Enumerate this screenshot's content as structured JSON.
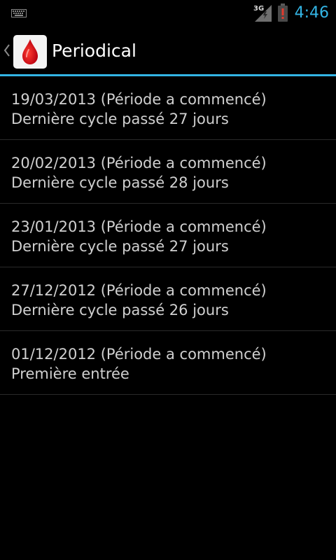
{
  "status_bar": {
    "network": "3G",
    "time": "4:46",
    "icons": [
      "keyboard-icon",
      "signal-icon",
      "battery-alert-icon"
    ],
    "time_color": "#33b5e5"
  },
  "action_bar": {
    "title": "Periodical",
    "logo_icon": "blood-drop-icon",
    "accent_color": "#33b5e5"
  },
  "entries": [
    {
      "date_line": "19/03/2013 (Période a commencé)",
      "detail": "Dernière cycle passé 27 jours"
    },
    {
      "date_line": "20/02/2013 (Période a commencé)",
      "detail": "Dernière cycle passé 28 jours"
    },
    {
      "date_line": "23/01/2013 (Période a commencé)",
      "detail": "Dernière cycle passé 27 jours"
    },
    {
      "date_line": "27/12/2012 (Période a commencé)",
      "detail": "Dernière cycle passé 26 jours"
    },
    {
      "date_line": "01/12/2012 (Période a commencé)",
      "detail": "Première entrée"
    }
  ]
}
